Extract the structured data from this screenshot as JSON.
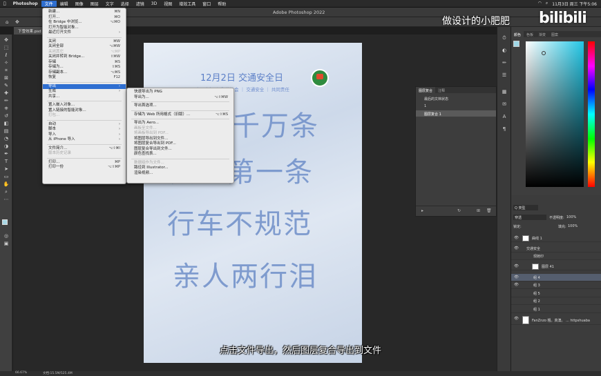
{
  "menubar": {
    "items": [
      "Photoshop",
      "文件",
      "编辑",
      "图像",
      "图层",
      "文字",
      "选择",
      "滤镜",
      "3D",
      "视图",
      "增效工具",
      "窗口",
      "帮助"
    ],
    "right_time": "11月3日 周三 下午5:06"
  },
  "window": {
    "title": "Adobe Photoshop 2022",
    "doc_tab": "下雪效果.psd"
  },
  "file_menu": {
    "items": [
      {
        "label": "新建...",
        "shortcut": "⌘N",
        "state": "normal"
      },
      {
        "label": "打开...",
        "shortcut": "⌘O",
        "state": "normal"
      },
      {
        "label": "在 Bridge 中浏览...",
        "shortcut": "⌥⌘O",
        "state": "normal"
      },
      {
        "label": "打开为智能对象...",
        "shortcut": "",
        "state": "normal"
      },
      {
        "label": "最近打开文件",
        "shortcut": "›",
        "state": "normal"
      },
      {
        "label": "sep"
      },
      {
        "label": "关闭",
        "shortcut": "⌘W",
        "state": "normal"
      },
      {
        "label": "关闭全部",
        "shortcut": "⌥⌘W",
        "state": "normal"
      },
      {
        "label": "关闭其它",
        "shortcut": "⌥⌘P",
        "state": "disabled"
      },
      {
        "label": "关闭并转到 Bridge...",
        "shortcut": "⇧⌘W",
        "state": "normal"
      },
      {
        "label": "存储",
        "shortcut": "⌘S",
        "state": "normal"
      },
      {
        "label": "存储为...",
        "shortcut": "⇧⌘S",
        "state": "normal"
      },
      {
        "label": "存储副本...",
        "shortcut": "⌥⌘S",
        "state": "normal"
      },
      {
        "label": "恢复",
        "shortcut": "F12",
        "state": "normal"
      },
      {
        "label": "sep"
      },
      {
        "label": "导出",
        "shortcut": "›",
        "state": "highlight"
      },
      {
        "label": "生成",
        "shortcut": "›",
        "state": "normal"
      },
      {
        "label": "共享...",
        "shortcut": "",
        "state": "normal"
      },
      {
        "label": "sep"
      },
      {
        "label": "置入嵌入对象...",
        "shortcut": "",
        "state": "normal"
      },
      {
        "label": "置入链接的智能对象...",
        "shortcut": "",
        "state": "normal"
      },
      {
        "label": "打包...",
        "shortcut": "",
        "state": "disabled"
      },
      {
        "label": "sep"
      },
      {
        "label": "自动",
        "shortcut": "›",
        "state": "normal"
      },
      {
        "label": "脚本",
        "shortcut": "›",
        "state": "normal"
      },
      {
        "label": "导入",
        "shortcut": "›",
        "state": "normal"
      },
      {
        "label": "从 iPhone 导入",
        "shortcut": "›",
        "state": "normal"
      },
      {
        "label": "sep"
      },
      {
        "label": "文件简介...",
        "shortcut": "⌥⇧⌘I",
        "state": "normal"
      },
      {
        "label": "版本历史记录",
        "shortcut": "",
        "state": "disabled"
      },
      {
        "label": "sep"
      },
      {
        "label": "打印...",
        "shortcut": "⌘P",
        "state": "normal"
      },
      {
        "label": "打印一份",
        "shortcut": "⌥⇧⌘P",
        "state": "normal"
      }
    ]
  },
  "export_submenu": {
    "items": [
      {
        "label": "快速导出为 PNG",
        "shortcut": "",
        "state": "normal"
      },
      {
        "label": "导出为...",
        "shortcut": "⌥⇧⌘W",
        "state": "normal"
      },
      {
        "label": "sep"
      },
      {
        "label": "导出首选项...",
        "shortcut": "",
        "state": "normal"
      },
      {
        "label": "sep"
      },
      {
        "label": "存储为 Web 所用格式（旧版）...",
        "shortcut": "⌥⇧⌘S",
        "state": "normal"
      },
      {
        "label": "sep"
      },
      {
        "label": "导出为 Aero...",
        "shortcut": "",
        "state": "normal"
      },
      {
        "label": "画板至文件...",
        "shortcut": "",
        "state": "disabled"
      },
      {
        "label": "将画板导出到 PDF...",
        "shortcut": "",
        "state": "disabled"
      },
      {
        "label": "将图层导出到文件...",
        "shortcut": "",
        "state": "normal"
      },
      {
        "label": "将图层复合导出到 PDF...",
        "shortcut": "",
        "state": "normal"
      },
      {
        "label": "图层复合导出到文件...",
        "shortcut": "",
        "state": "normal"
      },
      {
        "label": "颜色查找表...",
        "shortcut": "",
        "state": "normal"
      },
      {
        "label": "sep"
      },
      {
        "label": "数据组作为文件...",
        "shortcut": "",
        "state": "disabled"
      },
      {
        "label": "路径到 Illustrator...",
        "shortcut": "",
        "state": "normal"
      },
      {
        "label": "渲染视频...",
        "shortcut": "",
        "state": "normal"
      }
    ]
  },
  "document": {
    "title": "12月2日 交通安全日",
    "subtitle": "文明出行 ｜ 和谐社会 ｜ 交通安全 ｜ 共同责任",
    "lines": [
      "千万条",
      "安全第一条",
      "行车不规范",
      "亲人两行泪"
    ]
  },
  "right_panel": {
    "color_tabs": [
      "颜色",
      "色板",
      "渐变",
      "图案"
    ],
    "history_tabs": [
      "图层复合",
      "注释"
    ],
    "history_items": [
      "最后的文档状态",
      "1",
      "图层复合 1"
    ],
    "layer_tabs": [
      "图层",
      "通道",
      "路径"
    ],
    "layer_kind": "Q 类型",
    "blend_mode": "穿透",
    "opacity_label": "不透明度:",
    "opacity_value": "100%",
    "lock_label": "锁定:",
    "fill_label": "填充:",
    "fill_value": "100%",
    "layers": [
      {
        "name": "曲线 1",
        "selected": false
      },
      {
        "name": "交通安全",
        "selected": false
      },
      {
        "name": "现她印",
        "selected": false
      },
      {
        "name": "图层 41",
        "selected": false
      },
      {
        "name": "组 4",
        "selected": true
      },
      {
        "name": "组 3",
        "selected": false
      },
      {
        "name": "组 5",
        "selected": false
      },
      {
        "name": "组 2",
        "selected": false
      },
      {
        "name": "组 1",
        "selected": false
      },
      {
        "name": "FanZnzo 粗。真澳。 ... httpshuaba",
        "selected": false
      }
    ]
  },
  "status": {
    "zoom": "66.67%",
    "doc_info": "文档:15.5M/525.4M"
  },
  "overlay": {
    "subtitle": "点击文件导出，然后图层复合导出到文件",
    "watermark": "做设计的小肥肥",
    "bili": "bilibili"
  }
}
